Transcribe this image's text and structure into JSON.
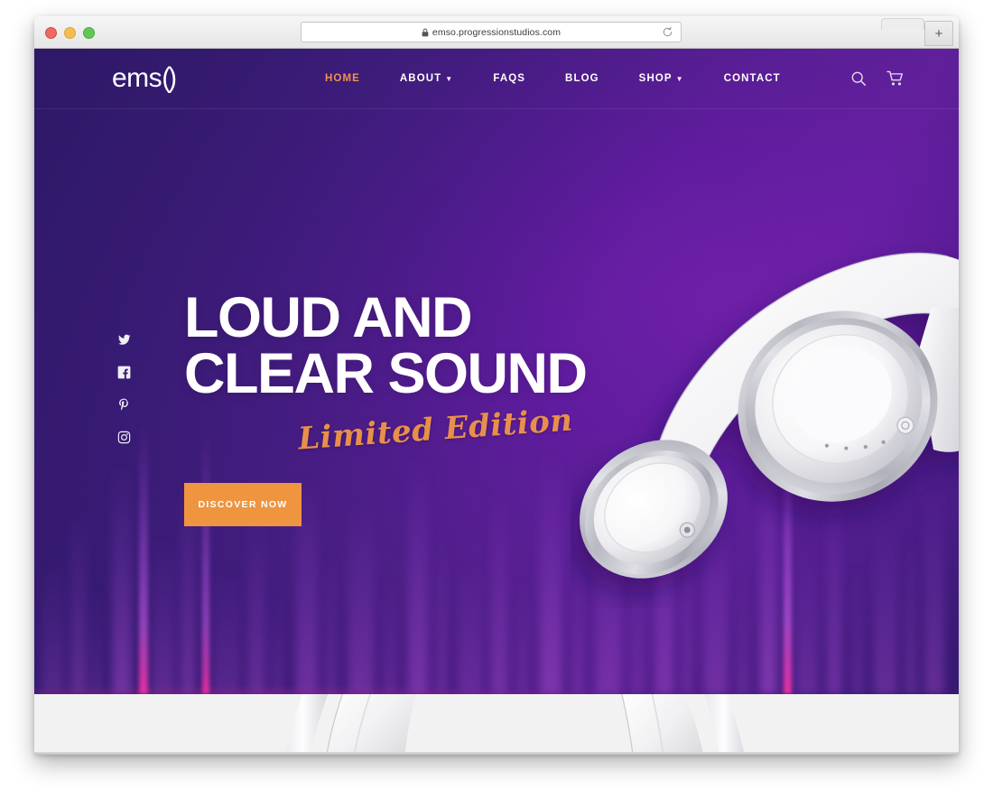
{
  "browser": {
    "url": "emso.progressionstudios.com",
    "lock_icon": "lock-icon",
    "reload_icon": "reload-icon",
    "new_tab_label": "+",
    "traffic_lights": [
      "close",
      "minimize",
      "zoom"
    ]
  },
  "site": {
    "logo": {
      "text": "ems",
      "mark": "o"
    },
    "nav": [
      {
        "label": "HOME",
        "active": true,
        "has_dropdown": false
      },
      {
        "label": "ABOUT",
        "active": false,
        "has_dropdown": true
      },
      {
        "label": "FAQS",
        "active": false,
        "has_dropdown": false
      },
      {
        "label": "BLOG",
        "active": false,
        "has_dropdown": false
      },
      {
        "label": "SHOP",
        "active": false,
        "has_dropdown": true
      },
      {
        "label": "CONTACT",
        "active": false,
        "has_dropdown": false
      }
    ],
    "header_icons": [
      {
        "name": "search-icon"
      },
      {
        "name": "cart-icon"
      }
    ],
    "social": [
      {
        "name": "twitter-icon"
      },
      {
        "name": "facebook-icon"
      },
      {
        "name": "pinterest-icon"
      },
      {
        "name": "instagram-icon"
      }
    ],
    "hero": {
      "title_line_1": "LOUD AND",
      "title_line_2": "CLEAR SOUND",
      "script_text": "Limited Edition",
      "cta_label": "DISCOVER NOW",
      "product_image": "white-headphones"
    },
    "below_fold": {
      "product_image": "white-headphones-row"
    }
  },
  "colors": {
    "hero_deep_purple": "#2d1866",
    "hero_bright_purple": "#6a1fa6",
    "accent_orange": "#ef9540",
    "script_orange": "#e8904b",
    "nav_active": "#f0934a",
    "eq_magenta": "#ec30a0",
    "below_fold_gray": "#f2f2f2",
    "white": "#ffffff"
  }
}
